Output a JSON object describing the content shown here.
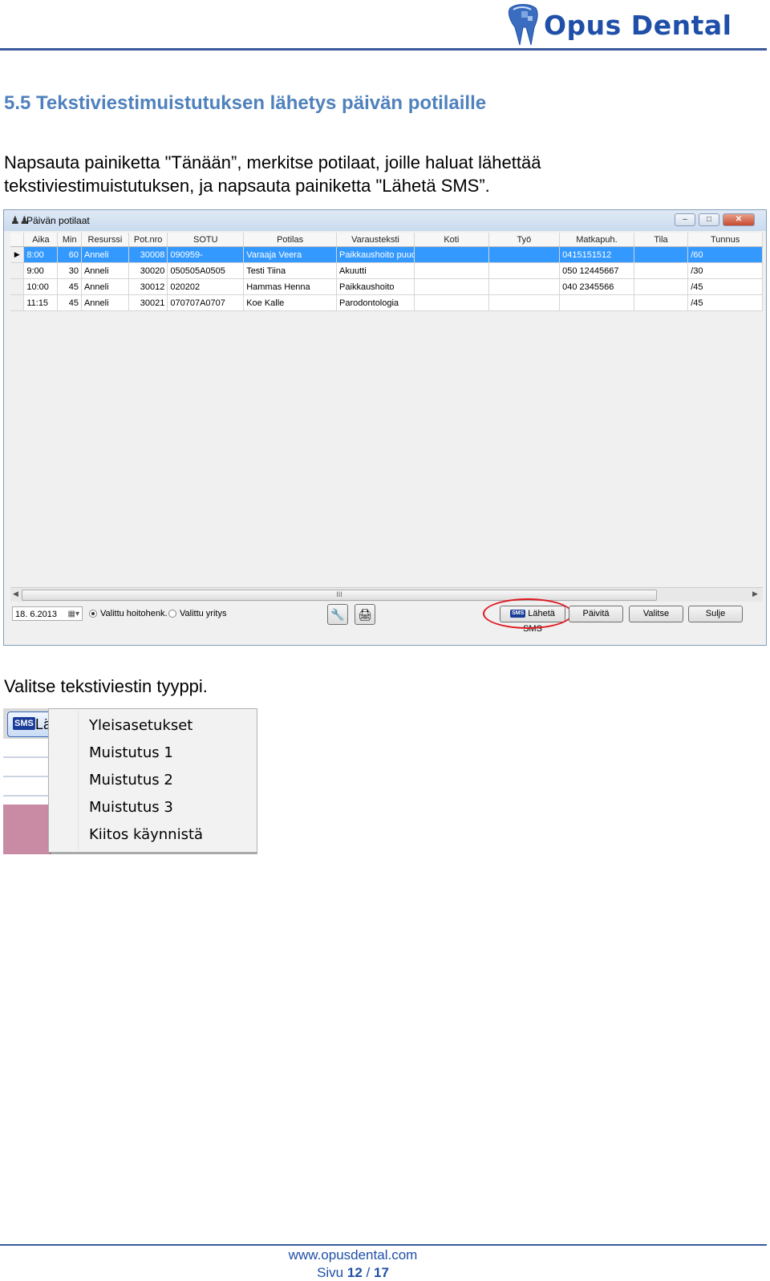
{
  "header": {
    "logo_text": "Opus Dental"
  },
  "section_title": "5.5 Tekstiviestimuistutuksen lähetys päivän potilaille",
  "intro_line1": "Napsauta painiketta \"Tänään”, merkitse potilaat, joille haluat lähettää",
  "intro_line2": "tekstiviestimuistutuksen, ja napsauta painiketta \"Lähetä SMS”.",
  "window": {
    "title": "Päivän potilaat",
    "columns": [
      "Aika",
      "Min",
      "Resurssi",
      "Pot.nro",
      "SOTU",
      "Potilas",
      "Varausteksti",
      "Koti",
      "Työ",
      "Matkapuh.",
      "Tila",
      "Tunnus"
    ],
    "rows": [
      {
        "aika": "8:00",
        "min": "60",
        "resurssi": "Anneli",
        "potnro": "30008",
        "sotu": "090959-",
        "potilas": "Varaaja Veera",
        "varausteksti": "Paikkaushoito puud+ p",
        "koti": "",
        "tyo": "",
        "matkapuh": "0415151512",
        "tila": "",
        "tunnus": "/60"
      },
      {
        "aika": "9:00",
        "min": "30",
        "resurssi": "Anneli",
        "potnro": "30020",
        "sotu": "050505A0505",
        "potilas": "Testi Tiina",
        "varausteksti": "Akuutti",
        "koti": "",
        "tyo": "",
        "matkapuh": "050 12445667",
        "tila": "",
        "tunnus": "/30"
      },
      {
        "aika": "10:00",
        "min": "45",
        "resurssi": "Anneli",
        "potnro": "30012",
        "sotu": "020202",
        "potilas": "Hammas Henna",
        "varausteksti": "Paikkaushoito",
        "koti": "",
        "tyo": "",
        "matkapuh": "040 2345566",
        "tila": "",
        "tunnus": "/45"
      },
      {
        "aika": "11:15",
        "min": "45",
        "resurssi": "Anneli",
        "potnro": "30021",
        "sotu": "070707A0707",
        "potilas": "Koe Kalle",
        "varausteksti": "Parodontologia",
        "koti": "",
        "tyo": "",
        "matkapuh": "",
        "tila": "",
        "tunnus": "/45"
      }
    ],
    "scroll_grip": "III",
    "date_value": "18. 6.2013",
    "radio_staff": "Valittu hoitohenk.",
    "radio_company": "Valittu yritys",
    "sms_icon": "SMS",
    "btn_sms": "Lähetä SMS",
    "btn_refresh": "Päivitä",
    "btn_select": "Valitse",
    "btn_close": "Sulje"
  },
  "caption2": "Valitse tekstiviestin tyyppi.",
  "menu": {
    "bg_button_label": "Lä",
    "items": [
      "Yleisasetukset",
      "Muistutus 1",
      "Muistutus 2",
      "Muistutus 3",
      "Kiitos käynnistä"
    ]
  },
  "footer": {
    "url": "www.opusdental.com",
    "page_label": "Sivu",
    "page_current": "12",
    "page_sep": "/",
    "page_total": "17"
  },
  "colors": {
    "brand_blue": "#1f4fa8",
    "title_blue": "#4f81bd",
    "selection": "#3399ff",
    "highlight_red": "#e0161e"
  }
}
